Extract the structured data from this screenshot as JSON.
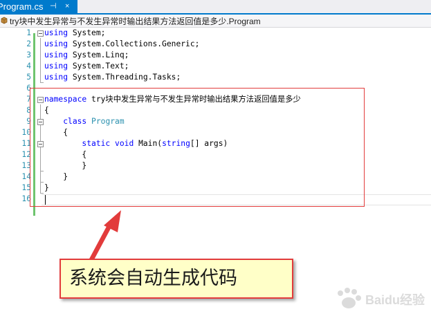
{
  "tab": {
    "label": "Program.cs",
    "pin": "⊣",
    "close": "×"
  },
  "nav": {
    "label": "try块中发生异常与不发生异常时输出结果方法返回值是多少.Program"
  },
  "code_lines": [
    {
      "n": "1",
      "tokens": [
        [
          "kw",
          "using"
        ],
        [
          "",
          " System;"
        ]
      ]
    },
    {
      "n": "2",
      "tokens": [
        [
          "kw",
          "using"
        ],
        [
          "",
          " System.Collections.Generic;"
        ]
      ]
    },
    {
      "n": "3",
      "tokens": [
        [
          "kw",
          "using"
        ],
        [
          "",
          " System.Linq;"
        ]
      ]
    },
    {
      "n": "4",
      "tokens": [
        [
          "kw",
          "using"
        ],
        [
          "",
          " System.Text;"
        ]
      ]
    },
    {
      "n": "5",
      "tokens": [
        [
          "kw",
          "using"
        ],
        [
          "",
          " System.Threading.Tasks;"
        ]
      ]
    },
    {
      "n": "6",
      "tokens": []
    },
    {
      "n": "7",
      "tokens": [
        [
          "kw",
          "namespace"
        ],
        [
          "",
          " try块中发生异常与不发生异常时输出结果方法返回值是多少"
        ]
      ]
    },
    {
      "n": "8",
      "tokens": [
        [
          "",
          "{"
        ]
      ]
    },
    {
      "n": "9",
      "tokens": [
        [
          "",
          "    "
        ],
        [
          "kw",
          "class"
        ],
        [
          "",
          " "
        ],
        [
          "ty",
          "Program"
        ]
      ]
    },
    {
      "n": "10",
      "tokens": [
        [
          "",
          "    {"
        ]
      ]
    },
    {
      "n": "11",
      "tokens": [
        [
          "",
          "        "
        ],
        [
          "kw",
          "static"
        ],
        [
          "",
          " "
        ],
        [
          "kw",
          "void"
        ],
        [
          "",
          " Main("
        ],
        [
          "kw",
          "string"
        ],
        [
          "",
          "[] args)"
        ]
      ]
    },
    {
      "n": "12",
      "tokens": [
        [
          "",
          "        {"
        ]
      ]
    },
    {
      "n": "13",
      "tokens": [
        [
          "",
          "        }"
        ]
      ]
    },
    {
      "n": "14",
      "tokens": [
        [
          "",
          "    }"
        ]
      ]
    },
    {
      "n": "15",
      "tokens": [
        [
          "",
          "}"
        ]
      ]
    },
    {
      "n": "16",
      "tokens": []
    }
  ],
  "callout": {
    "text": "系统会自动生成代码"
  },
  "watermark": {
    "text": "Baidu经验"
  },
  "colors": {
    "accent": "#007acc",
    "keyword": "#0000ff",
    "type": "#2b91af",
    "annotation": "#e23b3b",
    "callout_bg": "#ffffc8"
  }
}
